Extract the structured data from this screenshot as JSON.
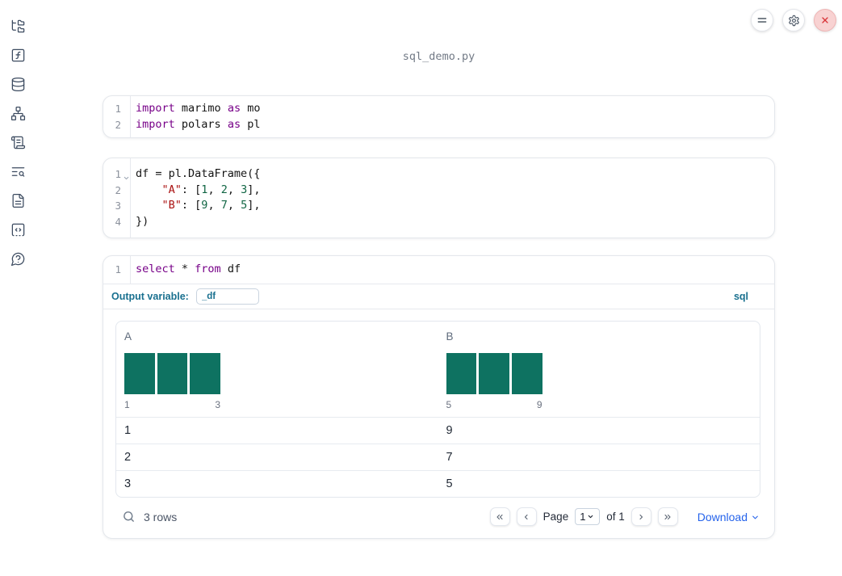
{
  "header": {
    "filename": "sql_demo.py",
    "control_icons": [
      "menu-icon",
      "settings-gear-icon",
      "shutdown-close-icon"
    ]
  },
  "sidebar": {
    "icons": [
      "file-explorer-tree-icon",
      "scratchpad-function-icon",
      "datasources-database-icon",
      "dependency-graph-icon",
      "logs-scroll-icon",
      "table-of-contents-search-icon",
      "documentation-file-icon",
      "snippets-code-icon",
      "help-question-bubble-icon"
    ]
  },
  "colors": {
    "keyword": "#770088",
    "string": "#aa1111",
    "number": "#116644",
    "histogram_bar": "#0e7261",
    "outvar_blue": "#19708f",
    "download_blue": "#2563eb",
    "close_red": "#d93438"
  },
  "cells": [
    {
      "kind": "python",
      "lines": [
        {
          "n": "1",
          "tokens": [
            [
              "kw",
              "import"
            ],
            [
              "pl",
              " marimo "
            ],
            [
              "kw",
              "as"
            ],
            [
              "pl",
              " mo"
            ]
          ]
        },
        {
          "n": "2",
          "tokens": [
            [
              "kw",
              "import"
            ],
            [
              "pl",
              " polars "
            ],
            [
              "kw",
              "as"
            ],
            [
              "pl",
              " pl"
            ]
          ]
        }
      ]
    },
    {
      "kind": "python",
      "lines": [
        {
          "n": "1",
          "fold": true,
          "tokens": [
            [
              "pl",
              "df = pl.DataFrame({"
            ]
          ]
        },
        {
          "n": "2",
          "tokens": [
            [
              "pl",
              "    "
            ],
            [
              "str",
              "\"A\""
            ],
            [
              "pl",
              ": ["
            ],
            [
              "num",
              "1"
            ],
            [
              "pl",
              ", "
            ],
            [
              "num",
              "2"
            ],
            [
              "pl",
              ", "
            ],
            [
              "num",
              "3"
            ],
            [
              "pl",
              "],"
            ]
          ]
        },
        {
          "n": "3",
          "tokens": [
            [
              "pl",
              "    "
            ],
            [
              "str",
              "\"B\""
            ],
            [
              "pl",
              ": ["
            ],
            [
              "num",
              "9"
            ],
            [
              "pl",
              ", "
            ],
            [
              "num",
              "7"
            ],
            [
              "pl",
              ", "
            ],
            [
              "num",
              "5"
            ],
            [
              "pl",
              "],"
            ]
          ]
        },
        {
          "n": "4",
          "tokens": [
            [
              "pl",
              "})"
            ]
          ]
        }
      ]
    },
    {
      "kind": "sql",
      "lines": [
        {
          "n": "1",
          "tokens": [
            [
              "kw",
              "select"
            ],
            [
              "pl",
              " * "
            ],
            [
              "kw",
              "from"
            ],
            [
              "pl",
              " df"
            ]
          ]
        }
      ]
    }
  ],
  "sql_cell": {
    "output_variable_label": "Output variable:",
    "output_variable_value": "_df",
    "language_badge": "sql"
  },
  "table": {
    "columns": [
      {
        "name": "A",
        "hist": {
          "values": [
            1,
            1,
            1
          ],
          "min_label": "1",
          "max_label": "3"
        }
      },
      {
        "name": "B",
        "hist": {
          "values": [
            1,
            1,
            1
          ],
          "min_label": "5",
          "max_label": "9"
        }
      }
    ],
    "rows": [
      [
        "1",
        "9"
      ],
      [
        "2",
        "7"
      ],
      [
        "3",
        "5"
      ]
    ],
    "footer": {
      "row_count": "3 rows",
      "page_label": "Page",
      "page_value": "1",
      "of_label": "of 1",
      "download_label": "Download"
    }
  }
}
